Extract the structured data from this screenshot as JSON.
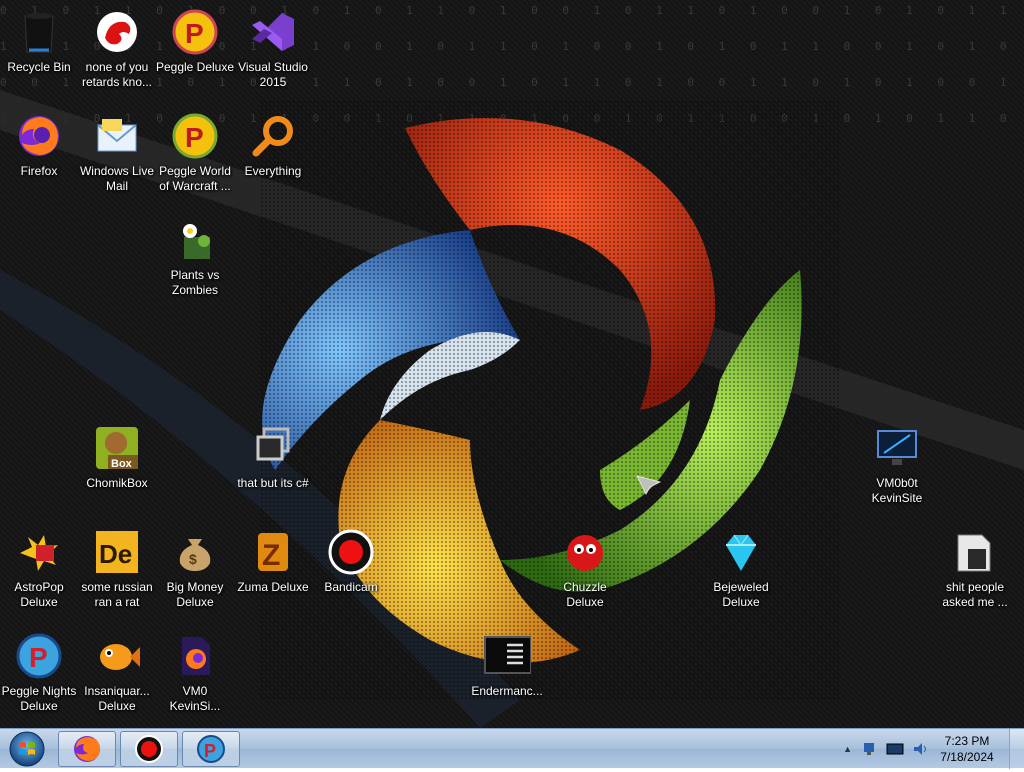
{
  "desktop": {
    "wallpaper_binary_rows": [
      "0 1 0 1 1 0 1 0 0 1 0 1 0 1 1 0 1 0 0 1 0 1 1 0 1 0 0 1 0 1 0 1 1 0 1 0 0 1",
      "1 0 1 0 0 1 1 0 1 0 1 0 0 1 0 1 1 0 1 0 0 1 0 1 0 1 1 0 0 1 0 1 0 0 1 1 0 1",
      "0 0 1 1 0 1 0 1 0 0 1 1 0 1 0 0 1 0 1 1 0 1 0 0 1 1 0 1 0 1 0 0 1 0 1 0 1 0",
      "1 1 0 0 1 0 1 0 1 1 0 0 1 0 1 1 0 1 0 0 1 0 1 1 0 0 1 0 1 0 1 1 0 1 0 0 1 1"
    ],
    "icons": [
      {
        "name": "recycle-bin",
        "label": "Recycle Bin",
        "icon": "recycle-bin-icon"
      },
      {
        "name": "none-of-you",
        "label": "none of you\nretards kno...",
        "icon": "red-dragon-icon"
      },
      {
        "name": "peggle-deluxe",
        "label": "Peggle Deluxe",
        "icon": "peggle-icon"
      },
      {
        "name": "visual-studio",
        "label": "Visual Studio\n2015",
        "icon": "visual-studio-icon"
      },
      {
        "name": "firefox",
        "label": "Firefox",
        "icon": "firefox-icon"
      },
      {
        "name": "windows-live-mail",
        "label": "Windows Live\nMail",
        "icon": "mail-icon"
      },
      {
        "name": "peggle-world",
        "label": "Peggle World\nof Warcraft ...",
        "icon": "peggle-icon"
      },
      {
        "name": "everything",
        "label": "Everything",
        "icon": "magnifier-icon"
      },
      {
        "name": "plants-vs-zombies",
        "label": "Plants vs\nZombies",
        "icon": "flower-icon"
      },
      {
        "name": "chomikbox",
        "label": "ChomikBox",
        "icon": "hamster-box-icon"
      },
      {
        "name": "that-but-c",
        "label": "that but its c#",
        "icon": "windows-stack-icon"
      },
      {
        "name": "vm0b0t",
        "label": "VM0b0t\nKevinSite",
        "icon": "monitor-icon"
      },
      {
        "name": "astropop",
        "label": "AstroPop\nDeluxe",
        "icon": "astropop-icon"
      },
      {
        "name": "some-russian",
        "label": "some russian\nran a rat",
        "icon": "de-icon"
      },
      {
        "name": "big-money",
        "label": "Big Money\nDeluxe",
        "icon": "money-bag-icon"
      },
      {
        "name": "zuma",
        "label": "Zuma Deluxe",
        "icon": "zuma-icon"
      },
      {
        "name": "bandicam",
        "label": "Bandicam",
        "icon": "record-icon"
      },
      {
        "name": "chuzzle",
        "label": "Chuzzle\nDeluxe",
        "icon": "chuzzle-icon"
      },
      {
        "name": "bejeweled",
        "label": "Bejeweled\nDeluxe",
        "icon": "diamond-icon"
      },
      {
        "name": "shit-people",
        "label": "shit people\nasked me ...",
        "icon": "folder-icon"
      },
      {
        "name": "peggle-nights",
        "label": "Peggle Nights\nDeluxe",
        "icon": "peggle-icon"
      },
      {
        "name": "insaniquarium",
        "label": "Insaniquar...\nDeluxe",
        "icon": "fish-icon"
      },
      {
        "name": "vm0-kevinsi",
        "label": "VM0\nKevinSi...",
        "icon": "firefox-file-icon"
      },
      {
        "name": "endermanch",
        "label": "Endermanc...",
        "icon": "console-icon"
      }
    ]
  },
  "taskbar": {
    "pinned": [
      {
        "name": "firefox",
        "icon": "firefox-icon"
      },
      {
        "name": "bandicam",
        "icon": "record-icon"
      },
      {
        "name": "peggle",
        "icon": "peggle-icon"
      }
    ],
    "tray": {
      "time": "7:23 PM",
      "date": "7/18/2024",
      "show_hidden": "▲"
    }
  },
  "colors": {
    "taskbar_top": "#c9d9ec",
    "taskbar_bottom": "#9ab6d6"
  }
}
